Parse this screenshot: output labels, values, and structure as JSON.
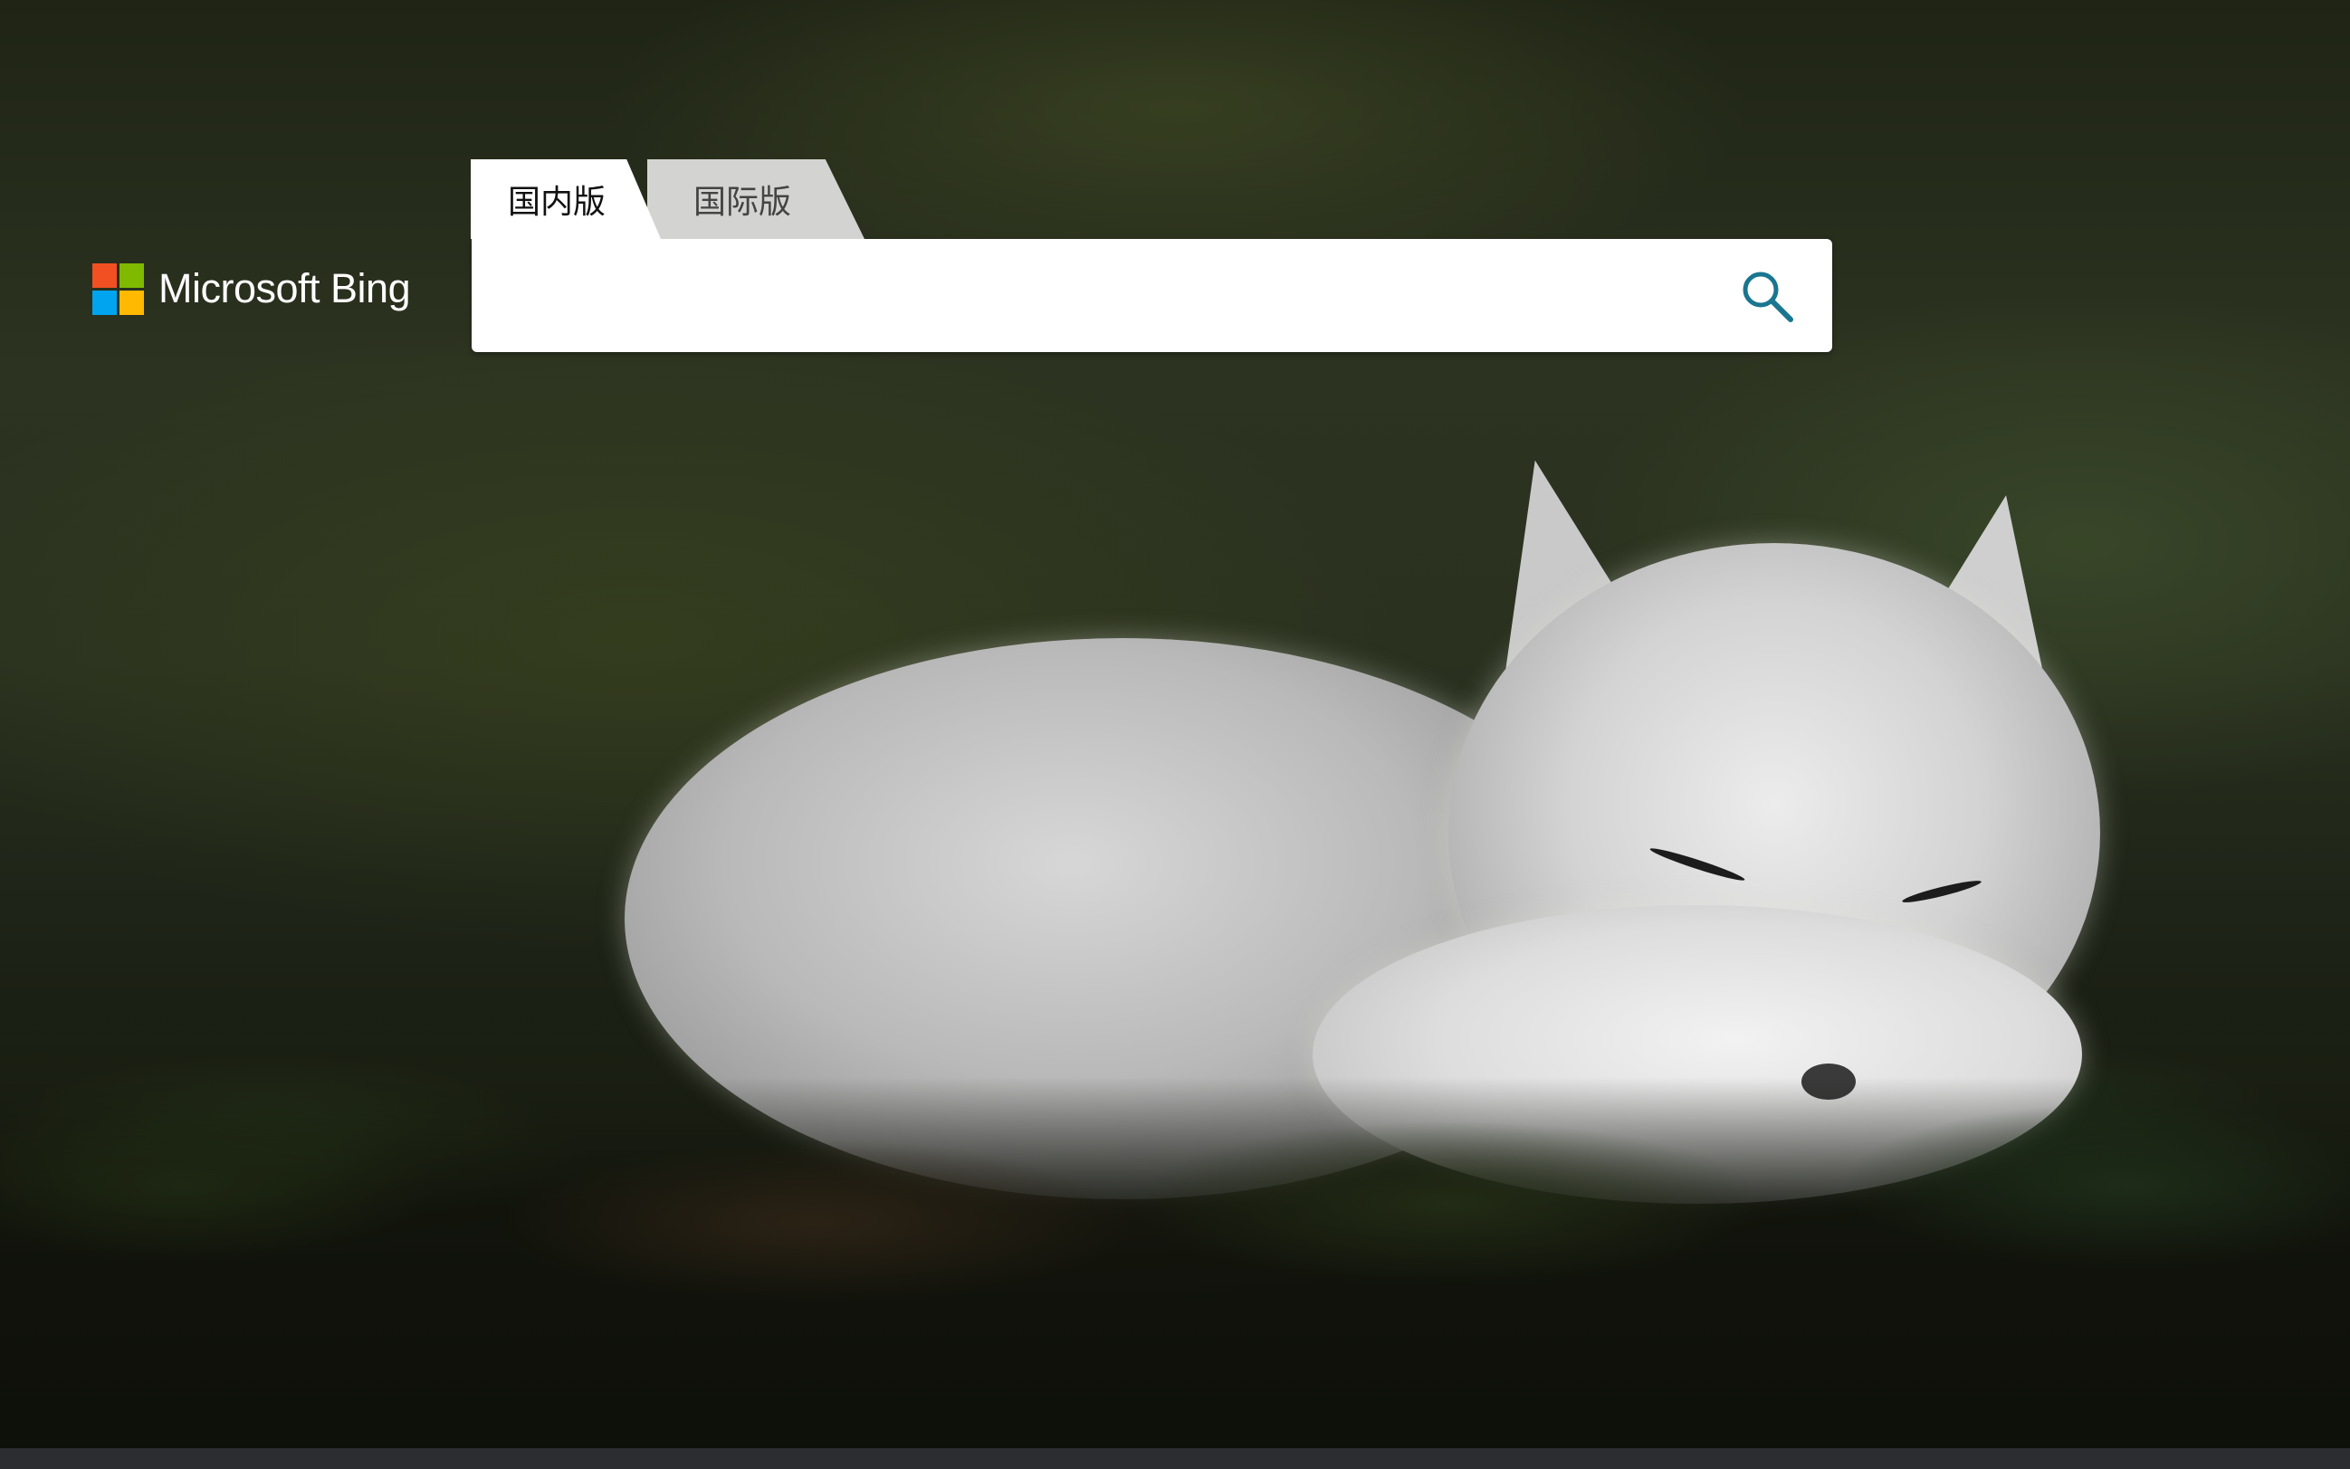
{
  "logo": {
    "text": "Microsoft Bing",
    "tile_colors": [
      "#f25022",
      "#7fba00",
      "#00a4ef",
      "#ffb900"
    ]
  },
  "tabs": [
    {
      "label": "国内版",
      "active": true
    },
    {
      "label": "国际版",
      "active": false
    }
  ],
  "search": {
    "value": "",
    "placeholder": "",
    "icon": "search-icon",
    "icon_color": "#1a7690"
  },
  "background": {
    "subject": "sleeping arctic fox on tundra vegetation"
  }
}
